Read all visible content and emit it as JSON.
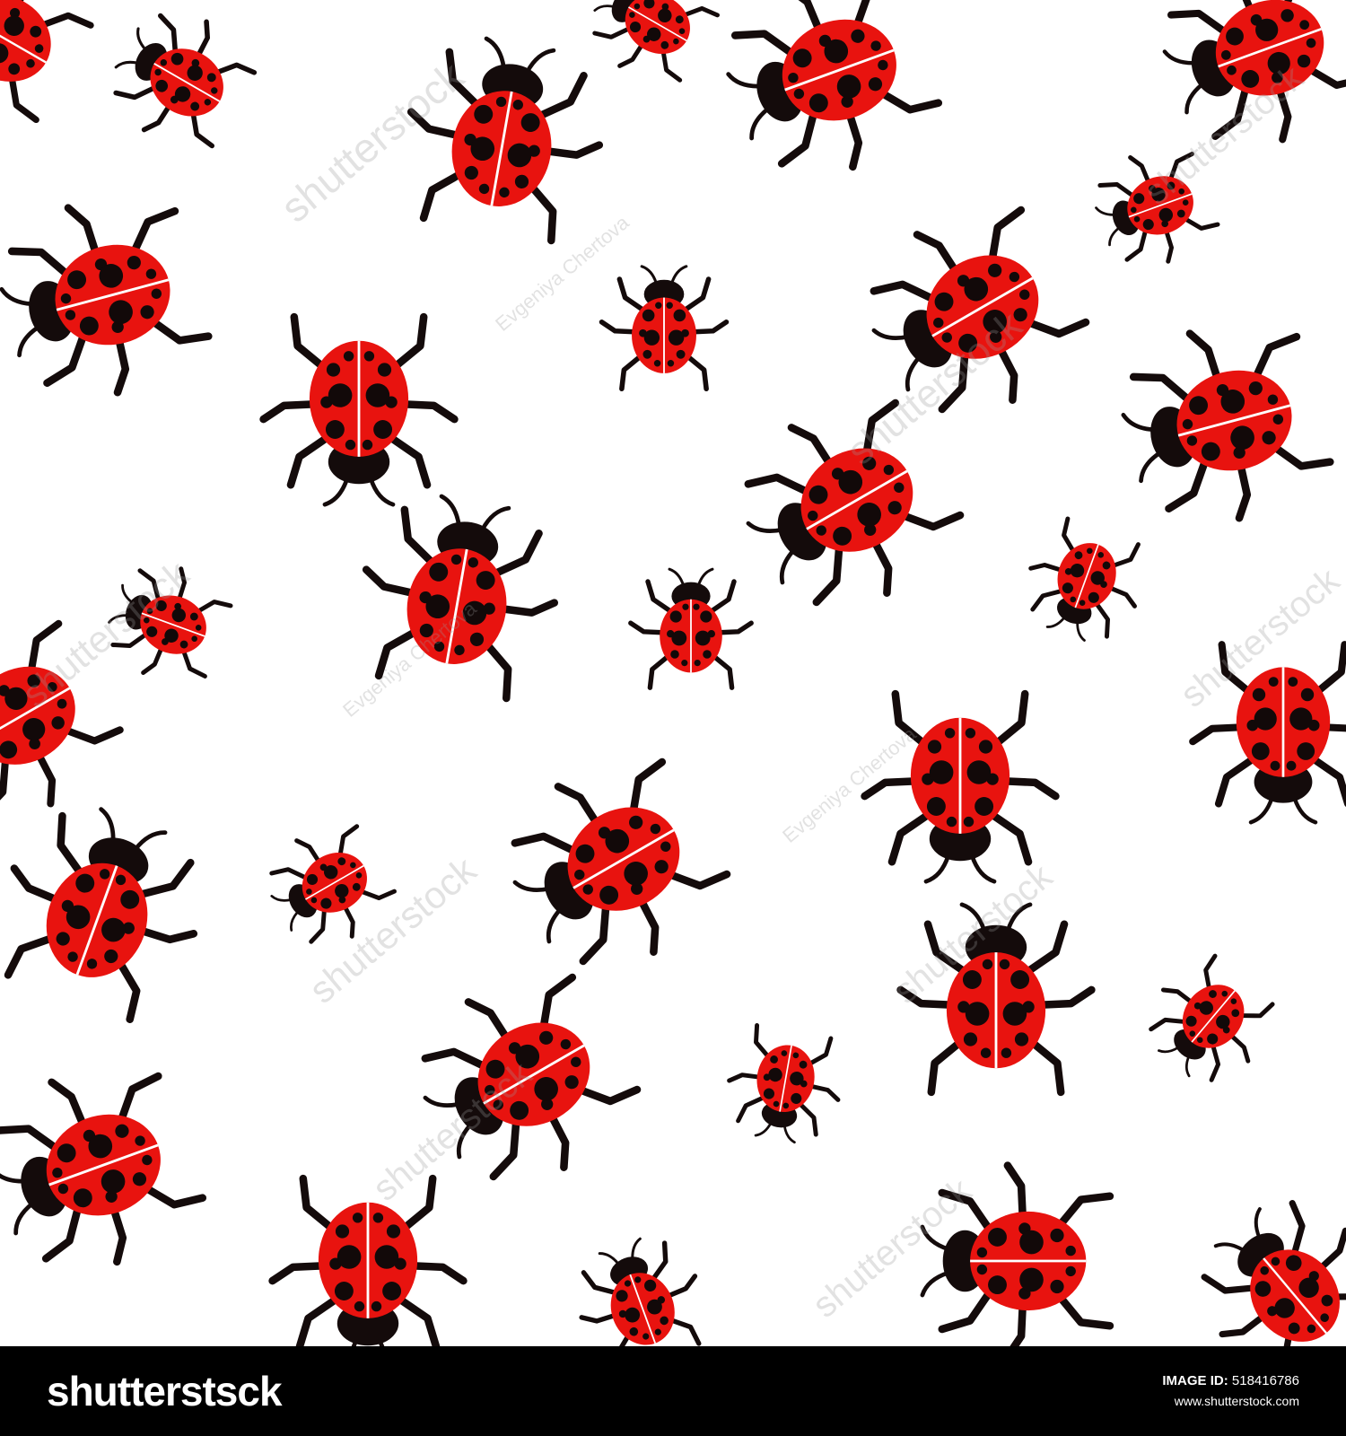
{
  "image": {
    "subject": "Seamless pattern of red ladybugs on white background",
    "colors": {
      "background": "#ffffff",
      "shell": "#e8130f",
      "spots": "#120909",
      "body": "#140b0b",
      "footer": "#000000"
    }
  },
  "watermark": {
    "brand": "shutterstock",
    "author": "Evgeniya Chertova"
  },
  "footer": {
    "logo": "shutterstsck",
    "image_id_label": "IMAGE ID:",
    "image_id_value": "518416786",
    "url": "www.shutterstock.com"
  }
}
